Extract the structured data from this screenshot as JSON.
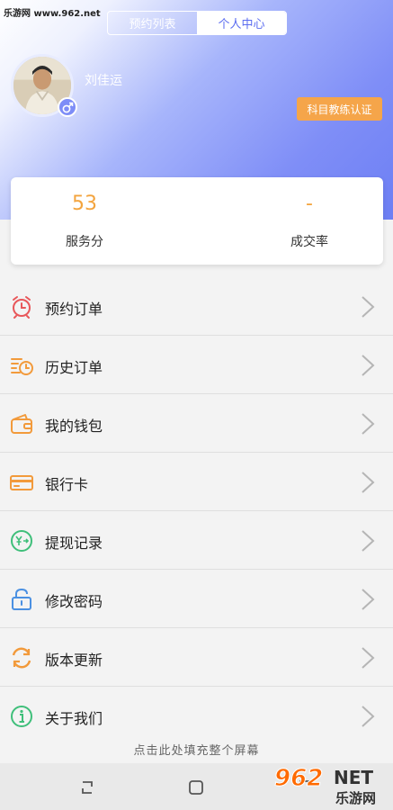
{
  "watermark": {
    "top_left": "乐游网 www.962.net",
    "brand_num": "962",
    "brand_net": "NET",
    "brand_cn": "乐游网"
  },
  "tabs": [
    {
      "label": "预约列表",
      "active": false
    },
    {
      "label": "个人中心",
      "active": true
    }
  ],
  "profile": {
    "username": "刘佳运",
    "gender_icon": "male-icon",
    "cert_button": "科目教练认证"
  },
  "stats": {
    "service_score": {
      "value": "53",
      "label": "服务分"
    },
    "deal_rate": {
      "value": "-",
      "label": "成交率"
    }
  },
  "menu": [
    {
      "label": "预约订单",
      "icon": "alarm-clock-icon"
    },
    {
      "label": "历史订单",
      "icon": "history-clock-icon"
    },
    {
      "label": "我的钱包",
      "icon": "wallet-icon"
    },
    {
      "label": "银行卡",
      "icon": "bank-card-icon"
    },
    {
      "label": "提现记录",
      "icon": "withdraw-icon"
    },
    {
      "label": "修改密码",
      "icon": "lock-icon"
    },
    {
      "label": "版本更新",
      "icon": "refresh-icon"
    },
    {
      "label": "关于我们",
      "icon": "info-icon"
    }
  ],
  "fullscreen_hint": "点击此处填充整个屏幕",
  "colors": {
    "accent": "#6d7ff4",
    "orange": "#f5a54a",
    "score": "#f3a43e"
  }
}
